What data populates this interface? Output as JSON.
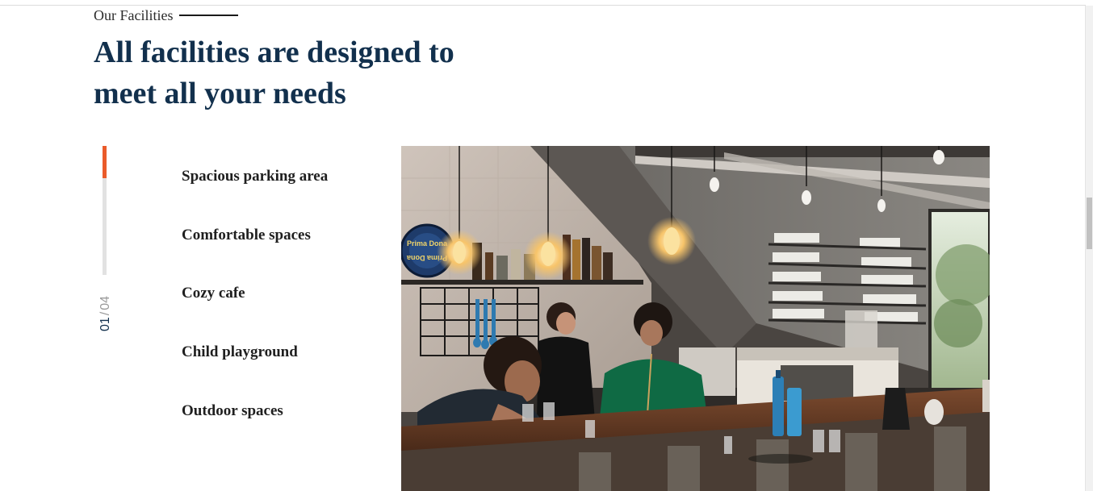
{
  "section": {
    "eyebrow": "Our Facilities",
    "headline_line1": "All facilities are designed to",
    "headline_line2": "meet all your needs"
  },
  "slider": {
    "current": "01",
    "separator": "/",
    "total": "04",
    "progress": 0.25,
    "accent_color": "#ea5b2a"
  },
  "facilities": {
    "items": [
      {
        "label": "Spacious parking area"
      },
      {
        "label": "Comfortable spaces"
      },
      {
        "label": "Cozy cafe"
      },
      {
        "label": "Child playground"
      },
      {
        "label": "Outdoor spaces"
      }
    ]
  },
  "photo": {
    "subject": "cafe-interior-photo",
    "badge_text_top": "Prima Dona",
    "badge_text_bottom": "Prima Dona"
  },
  "colors": {
    "heading": "#12304d",
    "text": "#1f1f1f",
    "accent": "#ea5b2a",
    "track": "#e2e2e2"
  }
}
